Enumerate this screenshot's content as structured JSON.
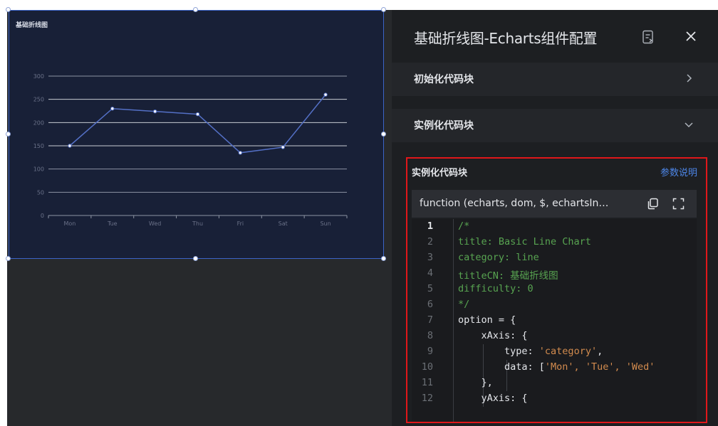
{
  "canvas": {
    "widget": {
      "title": "基础折线图"
    }
  },
  "chart_data": {
    "type": "line",
    "categories": [
      "Mon",
      "Tue",
      "Wed",
      "Thu",
      "Fri",
      "Sat",
      "Sun"
    ],
    "series": [
      {
        "values": [
          150,
          230,
          224,
          218,
          135,
          147,
          260
        ]
      }
    ],
    "title": "基础折线图",
    "xlabel": "",
    "ylabel": "",
    "ylim": [
      0,
      300
    ],
    "yticks": [
      0,
      50,
      100,
      150,
      200,
      250,
      300
    ],
    "grid": true,
    "line_color": "#5470c6"
  },
  "panel": {
    "title": "基础折线图-Echarts组件配置",
    "sections": [
      {
        "label": "初始化代码块",
        "state": "collapsed"
      },
      {
        "label": "实例化代码块",
        "state": "expanded"
      }
    ],
    "editor_box": {
      "label": "实例化代码块",
      "help_link": "参数说明",
      "function_signature": "function (echarts, dom, $, echartsIn…",
      "lines": [
        {
          "n": "1",
          "text": "/*",
          "kind": "comment",
          "active": true
        },
        {
          "n": "2",
          "text": "title: Basic Line Chart",
          "kind": "comment"
        },
        {
          "n": "3",
          "text": "category: line",
          "kind": "comment"
        },
        {
          "n": "4",
          "text": "titleCN: 基础折线图",
          "kind": "comment"
        },
        {
          "n": "5",
          "text": "difficulty: 0",
          "kind": "comment"
        },
        {
          "n": "6",
          "text": "*/",
          "kind": "comment"
        },
        {
          "n": "7",
          "text": "option = {",
          "kind": "plain"
        },
        {
          "n": "8",
          "text": "    xAxis: {",
          "kind": "plain"
        },
        {
          "n": "9",
          "pre": "        type: ",
          "str": "'category'",
          "post": ",",
          "kind": "mixed"
        },
        {
          "n": "10",
          "pre": "        data: [",
          "str": "'Mon', 'Tue', 'Wed'",
          "post": "",
          "kind": "mixed"
        },
        {
          "n": "11",
          "text": "    },",
          "kind": "plain"
        },
        {
          "n": "12",
          "text": "    yAxis: {",
          "kind": "plain"
        }
      ]
    }
  },
  "colors": {
    "accent_link": "#4d86e8",
    "highlight_border": "#e0171a",
    "comment": "#58a451",
    "string": "#d28b4e"
  }
}
